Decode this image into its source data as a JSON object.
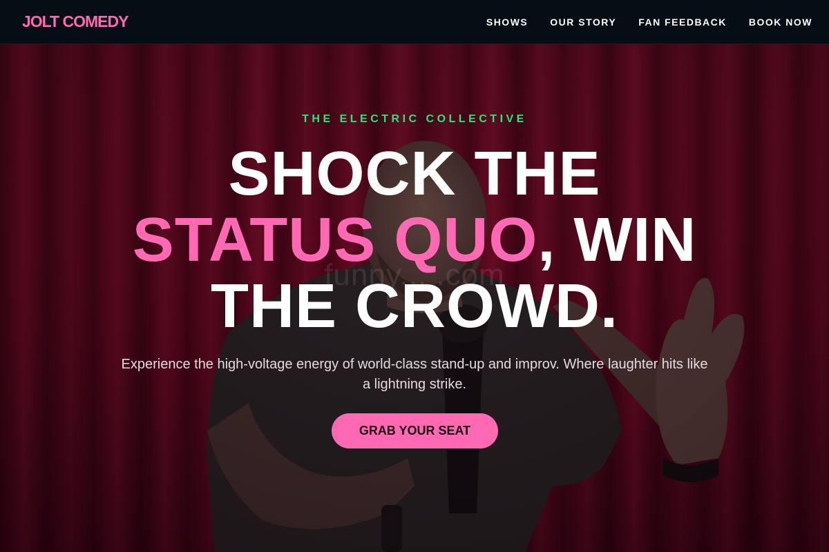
{
  "nav": {
    "brand": "JOLT COMEDY",
    "links": [
      {
        "label": "SHOWS"
      },
      {
        "label": "OUR STORY"
      },
      {
        "label": "FAN FEEDBACK"
      },
      {
        "label": "BOOK NOW"
      }
    ]
  },
  "hero": {
    "eyebrow": "THE ELECTRIC COLLECTIVE",
    "headline": {
      "line1": "SHOCK THE",
      "accent": "STATUS QUO",
      "line2_rest": ", WIN",
      "line3": "THE CROWD."
    },
    "subtext": "Experience the high-voltage energy of world-class stand-up and improv. Where laughter hits like a lightning strike.",
    "cta_label": "GRAB YOUR SEAT",
    "watermark": "funny... .com"
  },
  "colors": {
    "accent_pink": "#ff69b4",
    "eyebrow_green": "#2ee27d",
    "nav_bg": "#070d14",
    "curtain_red": "#8a0f2d"
  }
}
